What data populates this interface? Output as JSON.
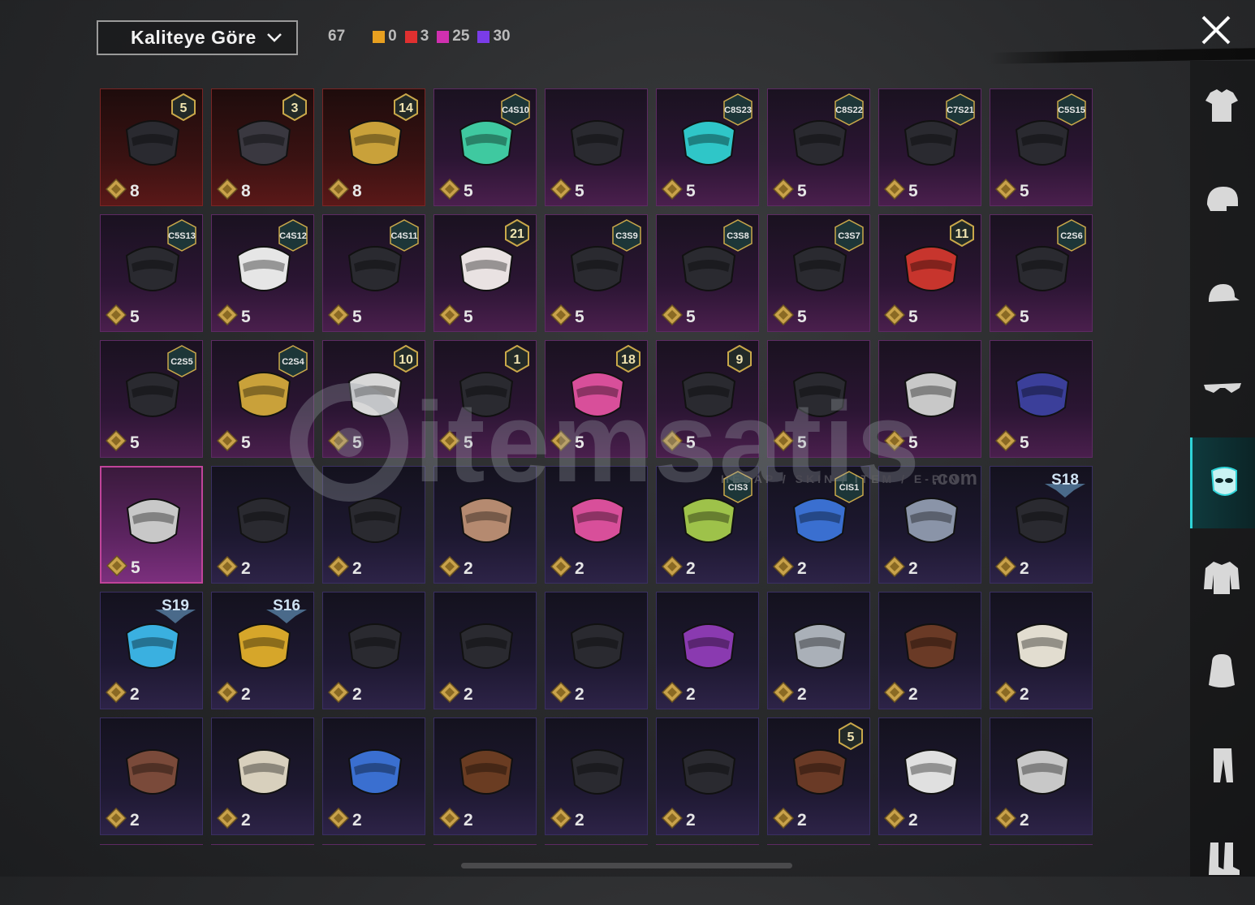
{
  "header": {
    "sort_label": "Kaliteye Göre",
    "total_count": "67",
    "quality_counts": [
      {
        "color": "#e8a020",
        "value": "0"
      },
      {
        "color": "#e03030",
        "value": "3"
      },
      {
        "color": "#d030b0",
        "value": "25"
      },
      {
        "color": "#7a3ce8",
        "value": "30"
      }
    ]
  },
  "watermark": {
    "brand": "itemsatis",
    "tagline": "HESAP / SKIN / ITEM / E-PIN",
    "domain": ".com"
  },
  "sidebar": {
    "categories": [
      {
        "name": "outfit-icon",
        "active": false
      },
      {
        "name": "helmet-icon",
        "active": false
      },
      {
        "name": "hat-icon",
        "active": false
      },
      {
        "name": "glasses-icon",
        "active": false
      },
      {
        "name": "mask-icon",
        "active": true
      },
      {
        "name": "jacket-icon",
        "active": false
      },
      {
        "name": "backpack-icon",
        "active": false
      },
      {
        "name": "pants-icon",
        "active": false
      },
      {
        "name": "boots-icon",
        "active": false
      }
    ]
  },
  "items": [
    {
      "quality": "red",
      "count": "8",
      "badge": "5",
      "badge_type": "level",
      "icon": "gas-mask-icon"
    },
    {
      "quality": "red",
      "count": "8",
      "badge": "3",
      "badge_type": "level",
      "icon": "wolf-mask-icon"
    },
    {
      "quality": "red",
      "count": "8",
      "badge": "14",
      "badge_type": "level",
      "icon": "golden-face-mask-icon"
    },
    {
      "quality": "pink",
      "count": "5",
      "badge": "C4S10",
      "badge_type": "season",
      "icon": "green-mask-icon"
    },
    {
      "quality": "pink",
      "count": "5",
      "badge": "",
      "badge_type": "",
      "icon": "bandana-icon"
    },
    {
      "quality": "pink",
      "count": "5",
      "badge": "C8S23",
      "badge_type": "season",
      "icon": "neon-mask-icon"
    },
    {
      "quality": "pink",
      "count": "5",
      "badge": "C8S22",
      "badge_type": "season",
      "icon": "black-mask-icon"
    },
    {
      "quality": "pink",
      "count": "5",
      "badge": "C7S21",
      "badge_type": "season",
      "icon": "tech-mask-icon"
    },
    {
      "quality": "pink",
      "count": "5",
      "badge": "C5S15",
      "badge_type": "season",
      "icon": "respirator-icon"
    },
    {
      "quality": "pink",
      "count": "5",
      "badge": "C5S13",
      "badge_type": "season",
      "icon": "graffiti-mask-icon"
    },
    {
      "quality": "pink",
      "count": "5",
      "badge": "C4S12",
      "badge_type": "season",
      "icon": "smile-mask-icon"
    },
    {
      "quality": "pink",
      "count": "5",
      "badge": "C4S11",
      "badge_type": "season",
      "icon": "face-mask-icon"
    },
    {
      "quality": "pink",
      "count": "5",
      "badge": "21",
      "badge_type": "level",
      "icon": "clown-mask-icon"
    },
    {
      "quality": "pink",
      "count": "5",
      "badge": "C3S9",
      "badge_type": "season",
      "icon": "gas-mask-icon"
    },
    {
      "quality": "pink",
      "count": "5",
      "badge": "C3S8",
      "badge_type": "season",
      "icon": "respirator-icon"
    },
    {
      "quality": "pink",
      "count": "5",
      "badge": "C3S7",
      "badge_type": "season",
      "icon": "chain-mask-icon"
    },
    {
      "quality": "pink",
      "count": "5",
      "badge": "11",
      "badge_type": "level",
      "icon": "oni-mask-icon"
    },
    {
      "quality": "pink",
      "count": "5",
      "badge": "C2S6",
      "badge_type": "season",
      "icon": "cyber-mask-icon"
    },
    {
      "quality": "pink",
      "count": "5",
      "badge": "C2S5",
      "badge_type": "season",
      "icon": "strap-mask-icon"
    },
    {
      "quality": "pink",
      "count": "5",
      "badge": "C2S4",
      "badge_type": "season",
      "icon": "gold-gas-mask-icon"
    },
    {
      "quality": "pink",
      "count": "5",
      "badge": "10",
      "badge_type": "level",
      "icon": "white-gas-mask-icon"
    },
    {
      "quality": "pink",
      "count": "5",
      "badge": "1",
      "badge_type": "level",
      "icon": "knight-helm-icon"
    },
    {
      "quality": "pink",
      "count": "5",
      "badge": "18",
      "badge_type": "level",
      "icon": "pink-mask-icon"
    },
    {
      "quality": "pink",
      "count": "5",
      "badge": "9",
      "badge_type": "level",
      "icon": "warrior-mask-icon"
    },
    {
      "quality": "pink",
      "count": "5",
      "badge": "",
      "badge_type": "",
      "icon": "plague-mask-icon"
    },
    {
      "quality": "pink",
      "count": "5",
      "badge": "",
      "badge_type": "",
      "icon": "skull-balaclava-icon"
    },
    {
      "quality": "pink",
      "count": "5",
      "badge": "",
      "badge_type": "",
      "icon": "galaxy-mask-icon"
    },
    {
      "quality": "selected",
      "count": "5",
      "badge": "",
      "badge_type": "",
      "icon": "skull-bandana-icon"
    },
    {
      "quality": "purple",
      "count": "2",
      "badge": "",
      "badge_type": "",
      "icon": "black-mask-icon"
    },
    {
      "quality": "purple",
      "count": "2",
      "badge": "",
      "badge_type": "",
      "icon": "goggles-icon"
    },
    {
      "quality": "purple",
      "count": "2",
      "badge": "",
      "badge_type": "",
      "icon": "mammoth-mask-icon"
    },
    {
      "quality": "purple",
      "count": "2",
      "badge": "",
      "badge_type": "",
      "icon": "pink-creature-mask-icon"
    },
    {
      "quality": "purple",
      "count": "2",
      "badge": "CIS3",
      "badge_type": "season",
      "icon": "cactus-bandana-icon"
    },
    {
      "quality": "purple",
      "count": "2",
      "badge": "CIS1",
      "badge_type": "season",
      "icon": "blue-mask-icon"
    },
    {
      "quality": "purple",
      "count": "2",
      "badge": "",
      "badge_type": "",
      "icon": "steel-mask-icon"
    },
    {
      "quality": "purple",
      "count": "2",
      "badge": "S18",
      "badge_type": "wing",
      "icon": "pulse-mask-icon"
    },
    {
      "quality": "purple",
      "count": "2",
      "badge": "S19",
      "badge_type": "wing",
      "icon": "visor-icon"
    },
    {
      "quality": "purple",
      "count": "2",
      "badge": "S16",
      "badge_type": "wing",
      "icon": "yellow-mask-icon"
    },
    {
      "quality": "purple",
      "count": "2",
      "badge": "",
      "badge_type": "",
      "icon": "bandana-icon"
    },
    {
      "quality": "purple",
      "count": "2",
      "badge": "",
      "badge_type": "",
      "icon": "eye-mask-icon"
    },
    {
      "quality": "purple",
      "count": "2",
      "badge": "",
      "badge_type": "",
      "icon": "masquerade-icon"
    },
    {
      "quality": "purple",
      "count": "2",
      "badge": "",
      "badge_type": "",
      "icon": "purple-gas-mask-icon"
    },
    {
      "quality": "purple",
      "count": "2",
      "badge": "",
      "badge_type": "",
      "icon": "metal-helm-icon"
    },
    {
      "quality": "purple",
      "count": "2",
      "badge": "",
      "badge_type": "",
      "icon": "scarf-mask-icon"
    },
    {
      "quality": "purple",
      "count": "2",
      "badge": "",
      "badge_type": "",
      "icon": "mummy-mask-icon"
    },
    {
      "quality": "purple",
      "count": "2",
      "badge": "",
      "badge_type": "",
      "icon": "monster-mouth-icon"
    },
    {
      "quality": "purple",
      "count": "2",
      "badge": "",
      "badge_type": "",
      "icon": "paisley-bandana-icon"
    },
    {
      "quality": "purple",
      "count": "2",
      "badge": "",
      "badge_type": "",
      "icon": "blue-bandana-icon"
    },
    {
      "quality": "purple",
      "count": "2",
      "badge": "",
      "badge_type": "",
      "icon": "mustache-icon"
    },
    {
      "quality": "purple",
      "count": "2",
      "badge": "",
      "badge_type": "",
      "icon": "hockey-mask-icon"
    },
    {
      "quality": "purple",
      "count": "2",
      "badge": "",
      "badge_type": "",
      "icon": "black-mask-icon"
    },
    {
      "quality": "purple",
      "count": "2",
      "badge": "5",
      "badge_type": "level",
      "icon": "scarf-icon"
    },
    {
      "quality": "purple",
      "count": "2",
      "badge": "",
      "badge_type": "",
      "icon": "ghost-mask-icon"
    },
    {
      "quality": "purple",
      "count": "2",
      "badge": "",
      "badge_type": "",
      "icon": "skull-helm-icon"
    }
  ]
}
